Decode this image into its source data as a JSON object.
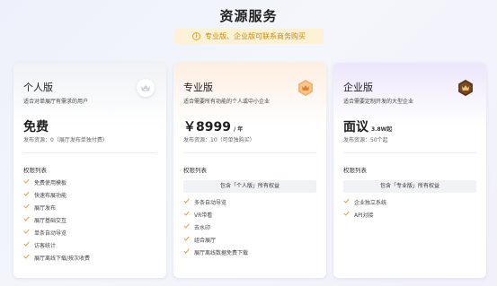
{
  "page": {
    "title": "资源服务",
    "notice": "专业版、企业版可联系商务购买"
  },
  "plans": {
    "personal": {
      "name": "个人版",
      "description": "适合对单展厅有需求的用户",
      "price": "免费",
      "unit": "",
      "issue_info": "发布资源：0（展厅发布单独付费）",
      "perm_title": "权限列表",
      "features": [
        "免费使用模板",
        "快速布展功能",
        "展厅发布",
        "展厅基础交互",
        "单条自动导览",
        "访客统计",
        "展厅离线下载/按次收费"
      ],
      "badge_color": "#c9c9c9"
    },
    "pro": {
      "name": "专业版",
      "description": "适合需要所有功能的个人或中小企业",
      "price": "￥8999",
      "unit": "/ 年",
      "issue_info": "发布资源：10（可单独购买）",
      "perm_title": "权限列表",
      "includes": "包含「个人版」所有权益",
      "features": [
        "多条自动导览",
        "VR带看",
        "去水印",
        "组合展厅",
        "展厅离线数据免费下载"
      ],
      "badge_color": "#f0a35a"
    },
    "enterprise": {
      "name": "企业版",
      "description": "适合需要定制开发的大型企业",
      "price": "面议",
      "unit": "3.8W起",
      "issue_info": "发布资源：50个起",
      "perm_title": "权限列表",
      "includes": "包含「专业版」所有权益",
      "features": [
        "企业独立系统",
        "API对接"
      ],
      "badge_color": "#6a3c1c"
    }
  },
  "colors": {
    "check": "#e9a44a",
    "notice_bg": "#fdf2d6",
    "notice_text": "#c08a1a"
  },
  "icons": {
    "notice": "info-circle-icon",
    "badge": "crown-icon",
    "feature": "check-icon"
  }
}
